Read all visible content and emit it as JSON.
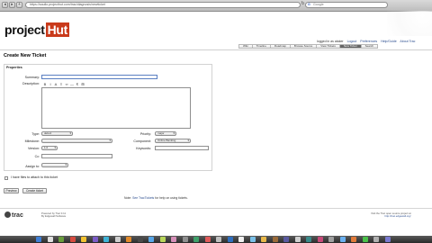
{
  "browser": {
    "url": "https://saullo.projecthut.com/trac/diagnosis/newticket",
    "search_placeholder": "Google",
    "search_glyph": "G",
    "back_glyph": "◂",
    "forward_glyph": "▸",
    "reload_glyph": "↻",
    "add_glyph": "+"
  },
  "logo": {
    "part1": "project",
    "part2": "Hut"
  },
  "meta": {
    "logged_in": "logged in as ataker",
    "logout": "Logout",
    "preferences": "Preferences",
    "help": "Help/Guide",
    "about": "About Trac"
  },
  "nav": [
    "Wiki",
    "Timeline",
    "Roadmap",
    "Browse Source",
    "View Tickets",
    "New Ticket",
    "Search"
  ],
  "nav_active_index": 5,
  "page": {
    "title": "Create New Ticket"
  },
  "form": {
    "legend": "Properties",
    "summary_label": "Summary:",
    "description_label": "Description:",
    "toolbar": [
      "B",
      "I",
      "A",
      "≡",
      "∞",
      "—",
      "¶",
      "⊞"
    ],
    "type_label": "Type:",
    "type_value": "defect",
    "priority_label": "Priority:",
    "priority_value": "major",
    "milestone_label": "Milestone:",
    "component_label": "Component:",
    "component_value": "Online Banking",
    "version_label": "Version:",
    "version_value": "1.0",
    "keywords_label": "Keywords:",
    "cc_label": "Cc:",
    "assign_label": "Assign to:",
    "checkbox_label": "I have files to attach to this ticket",
    "preview_button": "Preview",
    "create_button": "Create ticket",
    "note_prefix": "Note:",
    "note_link": "See TracTickets",
    "note_suffix": "for help on using tickets."
  },
  "footer": {
    "left1": "Powered by Trac 0.11",
    "left2": "By Edgewall Software",
    "right1": "Visit the Trac open source project at",
    "right2": "http://trac.edgewall.org/"
  },
  "trac_logo": "trac"
}
